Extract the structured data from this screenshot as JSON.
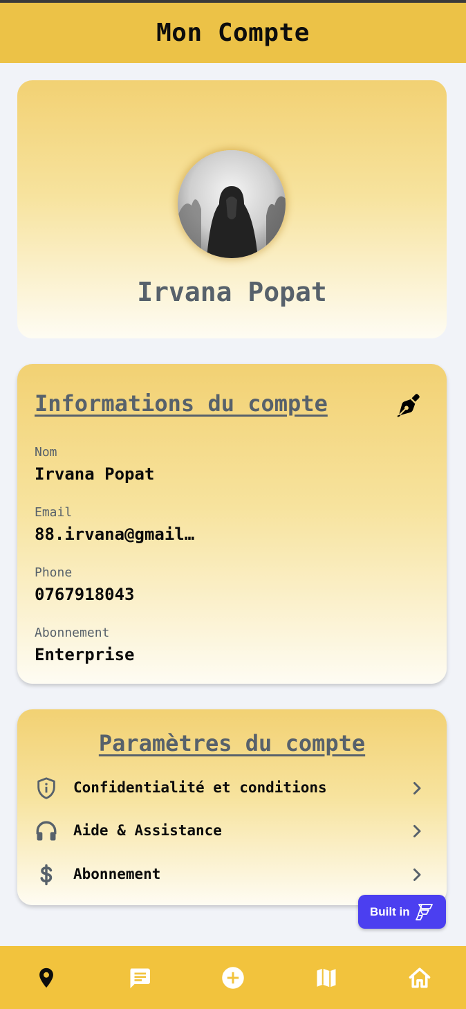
{
  "header": {
    "title": "Mon Compte"
  },
  "profile": {
    "name": "Irvana Popat"
  },
  "account_info": {
    "title": "Informations du compte",
    "edit_icon": "pen-nib-icon",
    "fields": [
      {
        "label": "Nom",
        "value": "Irvana Popat"
      },
      {
        "label": "Email",
        "value": "88.irvana@gmail…"
      },
      {
        "label": "Phone",
        "value": "0767918043"
      },
      {
        "label": "Abonnement",
        "value": "Enterprise"
      }
    ]
  },
  "settings": {
    "title": "Paramètres du compte",
    "items": [
      {
        "label": "Confidentialité et conditions",
        "icon": "shield-info-icon"
      },
      {
        "label": "Aide & Assistance",
        "icon": "headphones-icon"
      },
      {
        "label": "Abonnement",
        "icon": "dollar-icon"
      }
    ]
  },
  "badge": {
    "label": "Built in",
    "icon": "flutterflow-icon"
  },
  "bottom_nav": {
    "items": [
      {
        "icon": "location-pin-icon",
        "active": true
      },
      {
        "icon": "chat-icon",
        "active": false
      },
      {
        "icon": "add-circle-icon",
        "active": false
      },
      {
        "icon": "map-icon",
        "active": false
      },
      {
        "icon": "home-icon",
        "active": false
      }
    ]
  },
  "colors": {
    "header_bg": "#ecc247",
    "nav_bg": "#f2c33d",
    "card_gradient_top": "#f2d173",
    "card_gradient_bottom": "#fefcf3",
    "heading_text": "#57616b",
    "badge_bg": "#4b3ff0",
    "page_bg": "#f1f3f8"
  }
}
